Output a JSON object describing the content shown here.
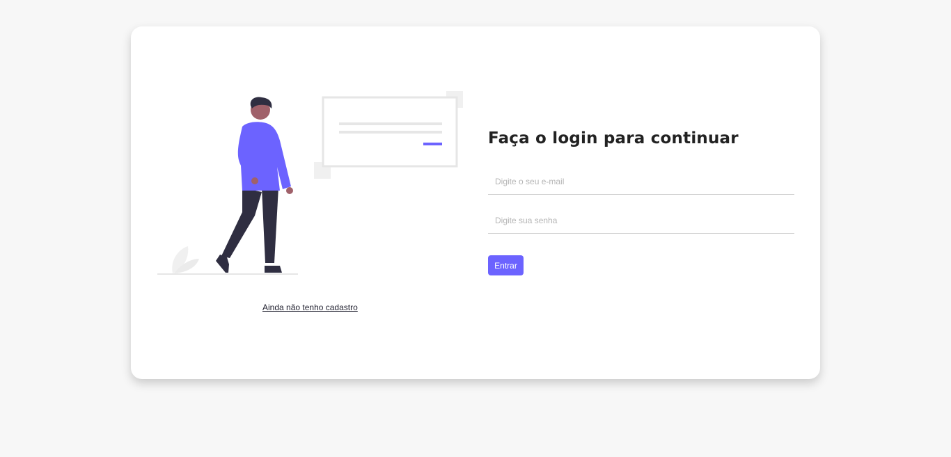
{
  "colors": {
    "page_background": "#f7f7f7",
    "card_background": "#ffffff",
    "accent": "#6c63ff",
    "title_text": "#222222",
    "illustration_dark": "#2f2e41",
    "illustration_skin": "#a0616a",
    "illustration_gray": "#e6e6e6"
  },
  "illustration": {
    "icon": "person-standing-with-message-card-icon"
  },
  "login": {
    "title": "Faça o login para continuar",
    "email_placeholder": "Digite o seu e-mail",
    "email_value": "",
    "password_placeholder": "Digite sua senha",
    "password_value": "",
    "submit_label": "Entrar"
  },
  "signup_link": "Ainda não tenho cadastro"
}
